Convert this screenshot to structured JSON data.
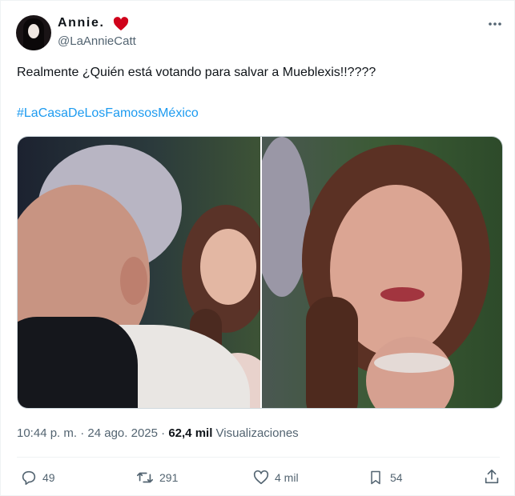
{
  "author": {
    "display_name": "Annie.",
    "handle": "@LaAnnieCatt",
    "badge_icon": "heart-icon",
    "badge_color": "#d0021b"
  },
  "tweet": {
    "text": "Realmente ¿Quién está votando para salvar a Mueblexis!!????",
    "hashtag": "#LaCasaDeLosFamososMéxico"
  },
  "meta": {
    "time": "10:44 p. m.",
    "separator": "·",
    "date": "24 ago. 2025",
    "views_count": "62,4 mil",
    "views_label": "Visualizaciones"
  },
  "actions": {
    "replies": "49",
    "retweets": "291",
    "likes": "4 mil",
    "bookmarks": "54"
  },
  "colors": {
    "text": "#0f1419",
    "secondary": "#536471",
    "link": "#1d9bf0",
    "border": "#eff3f4"
  }
}
